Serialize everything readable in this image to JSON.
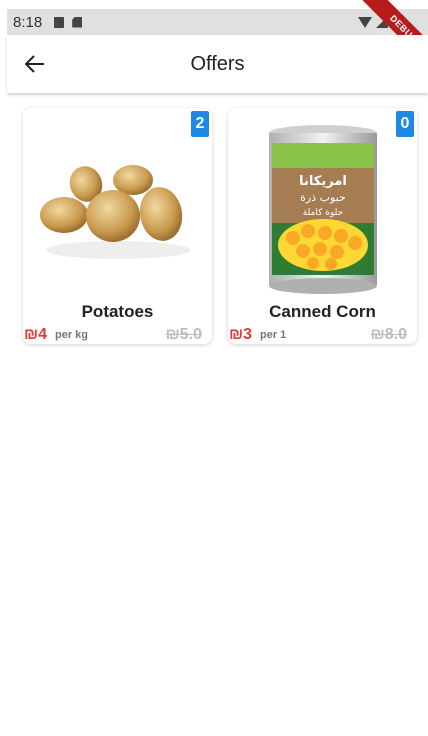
{
  "status_bar": {
    "time": "8:18"
  },
  "debug_banner": "DEBUG",
  "app_bar": {
    "title": "Offers"
  },
  "products": [
    {
      "badge": "2",
      "name": "Potatoes",
      "price": "₪4",
      "unit": "per kg",
      "old_price": "₪5.0",
      "image_icon": "potatoes-image"
    },
    {
      "badge": "0",
      "name": "Canned Corn",
      "price": "₪3",
      "unit": "per 1",
      "old_price": "₪8.0",
      "image_icon": "canned-corn-image",
      "can_label_arabic": "امريكانا",
      "can_label_line2": "حبوب ذرة",
      "can_label_line3": "حلوة كاملة"
    }
  ],
  "colors": {
    "accent": "#1e88e5",
    "price": "#e53935",
    "debug": "#b71c1c"
  }
}
